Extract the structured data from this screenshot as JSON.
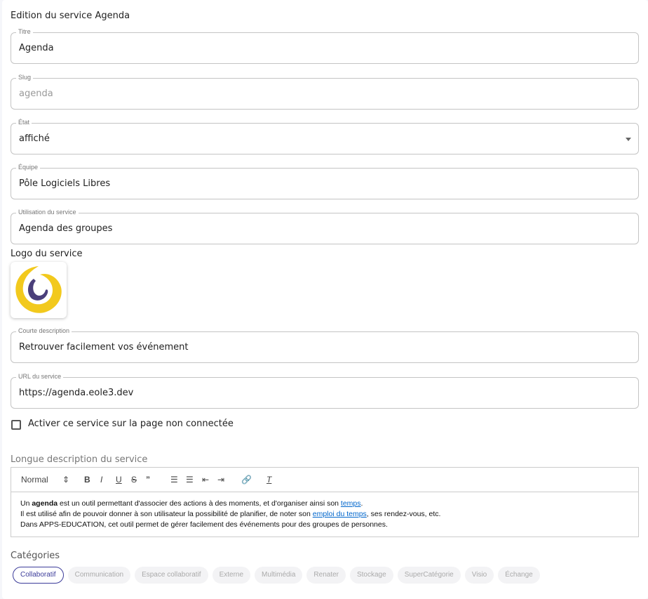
{
  "header": {
    "prefix": "Edition du service ",
    "name": "Agenda"
  },
  "fields": {
    "titre": {
      "label": "Titre",
      "value": "Agenda"
    },
    "slug": {
      "label": "Slug",
      "value": "agenda"
    },
    "etat": {
      "label": "État",
      "value": "affiché"
    },
    "equipe": {
      "label": "Équipe",
      "value": "Pôle Logiciels Libres"
    },
    "usage": {
      "label": "Utilisation du service",
      "value": "Agenda des groupes"
    },
    "short": {
      "label": "Courte description",
      "value": "Retrouver facilement vos événement"
    },
    "url": {
      "label": "URL du service",
      "value": "https://agenda.eole3.dev"
    }
  },
  "logo": {
    "label": "Logo du service",
    "colors": {
      "outer": "#f2c91d",
      "inner": "#4a3f7a"
    }
  },
  "checkbox": {
    "label": "Activer ce service sur la page non connectée",
    "checked": false
  },
  "long": {
    "label": "Longue description du service",
    "format": "Normal",
    "l1a": "Un ",
    "l1b": "agenda",
    "l1c": " est un outil permettant d'associer des actions à des moments, et d'organiser ainsi son ",
    "l1d": "temps",
    "l1e": ".",
    "l2a": "Il est utilisé afin de pouvoir donner à son utilisateur la possibilité de planifier, de noter son ",
    "l2b": "emploi du temps",
    "l2c": ", ses rendez-vous, etc.",
    "l3": "Dans APPS-EDUCATION, cet outil permet de gérer facilement des événements pour des groupes de personnes."
  },
  "categories": {
    "label": "Catégories",
    "items": [
      "Collaboratif",
      "Communication",
      "Espace collaboratif",
      "Externe",
      "Multimédia",
      "Renater",
      "Stockage",
      "SuperCatégorie",
      "Visio",
      "Échange"
    ],
    "selected": "Collaboratif"
  }
}
